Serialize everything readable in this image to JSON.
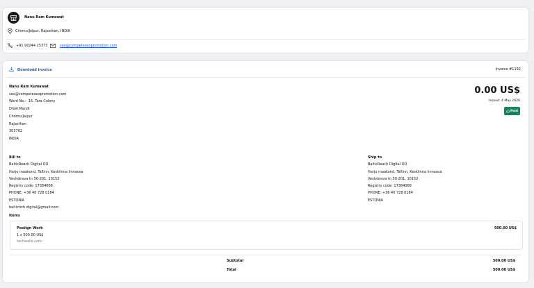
{
  "seller": {
    "name": "Nanu Ram Kumawat",
    "location": "Chomu/Jaipur, Rajasthan, INDIA",
    "phone": "+91 90244 25373",
    "email": "seo@competeseopromotion.com"
  },
  "invoice": {
    "download_label": "Download invoice",
    "number": "Invoice #1192",
    "from_lines": [
      "Nanu Ram Kumawat",
      "seo@competeseopromotion.com",
      "Ward No.:- 15, Tara Colony",
      "Dholi Mandi",
      "Chomu/Jaipur",
      "Rajasthan",
      "303702",
      "INDIA"
    ],
    "total_amount": "0.00 US$",
    "issued": "Issued: 4 May 2026",
    "status": "Paid",
    "bill_to_label": "Bill to",
    "bill_to": [
      "BalticReach Digital OÜ",
      "Harju maakond, Tallinn, Kesklinna linnaosa",
      "Veslvärava tn 50-201, 10152",
      "Registry code: 17384068",
      "PHONE: +36 40 728 0184",
      "ESTONIA",
      "balticrich.digital@gmail.com"
    ],
    "ship_to_label": "Ship to",
    "ship_to": [
      "BalticReach Digital OÜ",
      "Harju maakond, Tallinn, Kesklinna linnaosa",
      "Veslvärava tn 50-201, 10152",
      "Registry code: 17384068",
      "PHONE: +36 40 728 0184",
      "ESTONIA"
    ],
    "items_label": "Items",
    "item": {
      "name": "Postign Work",
      "qty": "1 x 500.00 US$",
      "site": "techwalls.com",
      "amount": "500.00 US$"
    },
    "subtotal_label": "Subtotal",
    "subtotal": "500.00 US$",
    "total_label": "Total",
    "total": "500.00 US$"
  }
}
